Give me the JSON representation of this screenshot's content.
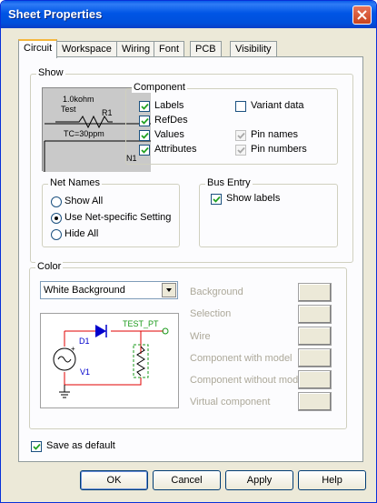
{
  "window": {
    "title": "Sheet Properties"
  },
  "tabs": [
    {
      "label": "Circuit"
    },
    {
      "label": "Workspace"
    },
    {
      "label": "Wiring"
    },
    {
      "label": "Font"
    },
    {
      "label": "PCB"
    },
    {
      "label": "Visibility"
    }
  ],
  "show_group": {
    "title": "Show"
  },
  "preview": {
    "value": "1.0kohm",
    "test_label": "Test",
    "ref": "R1",
    "tc": "TC=30ppm",
    "net": "N1"
  },
  "component": {
    "title": "Component",
    "labels": {
      "label": "Labels",
      "checked": true
    },
    "refdes": {
      "label": "RefDes",
      "checked": true
    },
    "values": {
      "label": "Values",
      "checked": true
    },
    "attributes": {
      "label": "Attributes",
      "checked": true
    },
    "variant_data": {
      "label": "Variant data",
      "checked": false
    },
    "pin_names": {
      "label": "Pin names",
      "checked": true,
      "disabled": true
    },
    "pin_numbers": {
      "label": "Pin numbers",
      "checked": true,
      "disabled": true
    }
  },
  "net_names": {
    "title": "Net Names",
    "options": [
      "Show All",
      "Use Net-specific Setting",
      "Hide All"
    ],
    "selected": "Use Net-specific Setting"
  },
  "bus_entry": {
    "title": "Bus Entry",
    "show_labels": {
      "label": "Show labels",
      "checked": true
    }
  },
  "color_group": {
    "title": "Color",
    "scheme": "White Background",
    "items": [
      "Background",
      "Selection",
      "Wire",
      "Component with model",
      "Component without model",
      "Virtual component"
    ]
  },
  "circuit_preview": {
    "d1": "D1",
    "test_pt": "TEST_PT",
    "v1": "V1"
  },
  "save_default": {
    "label": "Save as default",
    "checked": true
  },
  "buttons": {
    "ok": "OK",
    "cancel": "Cancel",
    "apply": "Apply",
    "help": "Help"
  }
}
